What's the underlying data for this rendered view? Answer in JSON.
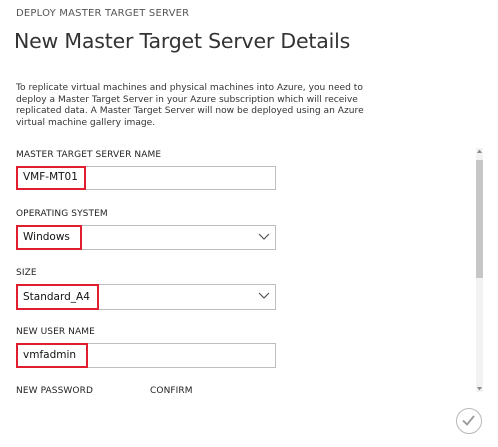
{
  "dialog": {
    "section": "DEPLOY MASTER TARGET SERVER",
    "title": "New Master Target Server Details",
    "intro": "To replicate virtual machines and physical machines into Azure, you need to deploy a Master Target Server in your Azure subscription which will receive replicated data. A Master Target Server will now be deployed using an Azure virtual machine gallery image."
  },
  "form": {
    "server_name": {
      "label": "MASTER TARGET SERVER NAME",
      "value": "VMF-MT01"
    },
    "os": {
      "label": "OPERATING SYSTEM",
      "value": "Windows"
    },
    "size": {
      "label": "SIZE",
      "value": "Standard_A4"
    },
    "user_name": {
      "label": "NEW USER NAME",
      "value": "vmfadmin"
    },
    "password": {
      "label": "NEW PASSWORD"
    },
    "confirm": {
      "label": "CONFIRM"
    }
  },
  "icons": {
    "dropdown": "chevron-down-icon",
    "complete": "checkmark-icon",
    "scroll_up": "scroll-up-arrow-icon",
    "scroll_down": "scroll-down-arrow-icon"
  },
  "colors": {
    "highlight": "#e01e2e",
    "field_border": "#bdbdbd",
    "scroll_thumb": "#c6c6c6"
  }
}
